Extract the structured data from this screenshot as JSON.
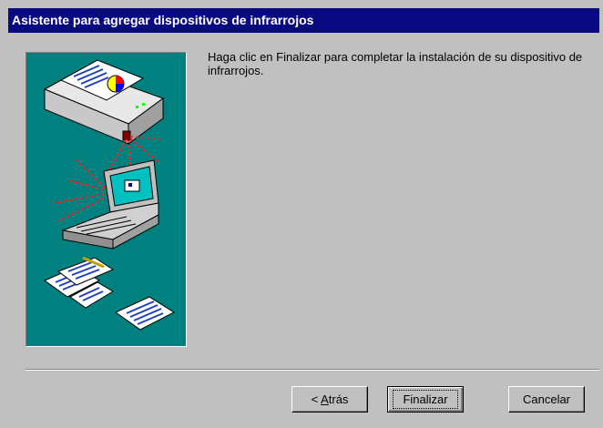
{
  "window": {
    "title": "Asistente para agregar dispositivos de infrarrojos",
    "titlebar_color": "#0a0a80",
    "background": "#c0c0c0"
  },
  "illustration": {
    "background": "#00807f",
    "icons": [
      "printer-icon",
      "laptop-icon",
      "documents-icon"
    ]
  },
  "message": "Haga clic en Finalizar para completar la instalación de su dispositivo de infrarrojos.",
  "buttons": {
    "back": {
      "prefix": "< ",
      "mnemonic": "A",
      "rest": "trás"
    },
    "finish": "Finalizar",
    "cancel": "Cancelar"
  }
}
